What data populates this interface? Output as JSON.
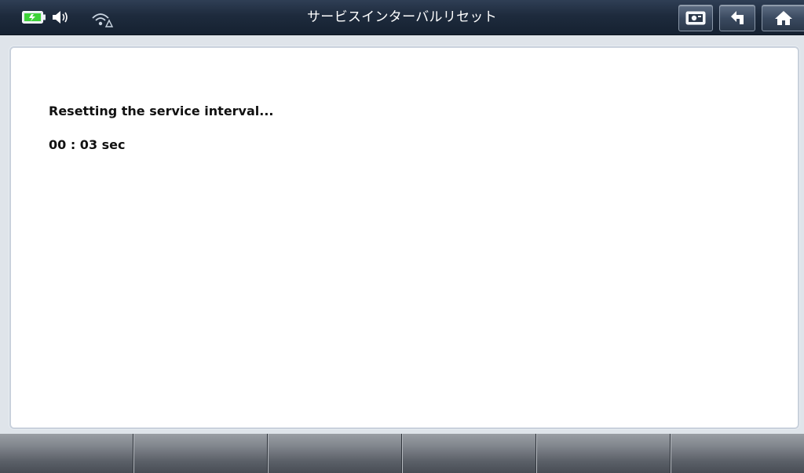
{
  "header": {
    "title": "サービスインターバルリセット",
    "status_icons": [
      "battery-icon",
      "speaker-icon",
      "wifi-icon"
    ],
    "buttons": [
      {
        "name": "screenshot-button",
        "icon": "screenshot-icon"
      },
      {
        "name": "back-button",
        "icon": "back-arrow-icon"
      },
      {
        "name": "home-button",
        "icon": "home-icon"
      }
    ]
  },
  "main": {
    "message": "Resetting the service interval...",
    "timer": "00 : 03 sec"
  },
  "footer": {
    "function_keys": [
      "",
      "",
      "",
      "",
      "",
      ""
    ]
  },
  "colors": {
    "topbar": "#1e2b3d",
    "battery_accent": "#3ed23a",
    "panel_border": "#c9d1dc",
    "function_key": "#82878e"
  }
}
